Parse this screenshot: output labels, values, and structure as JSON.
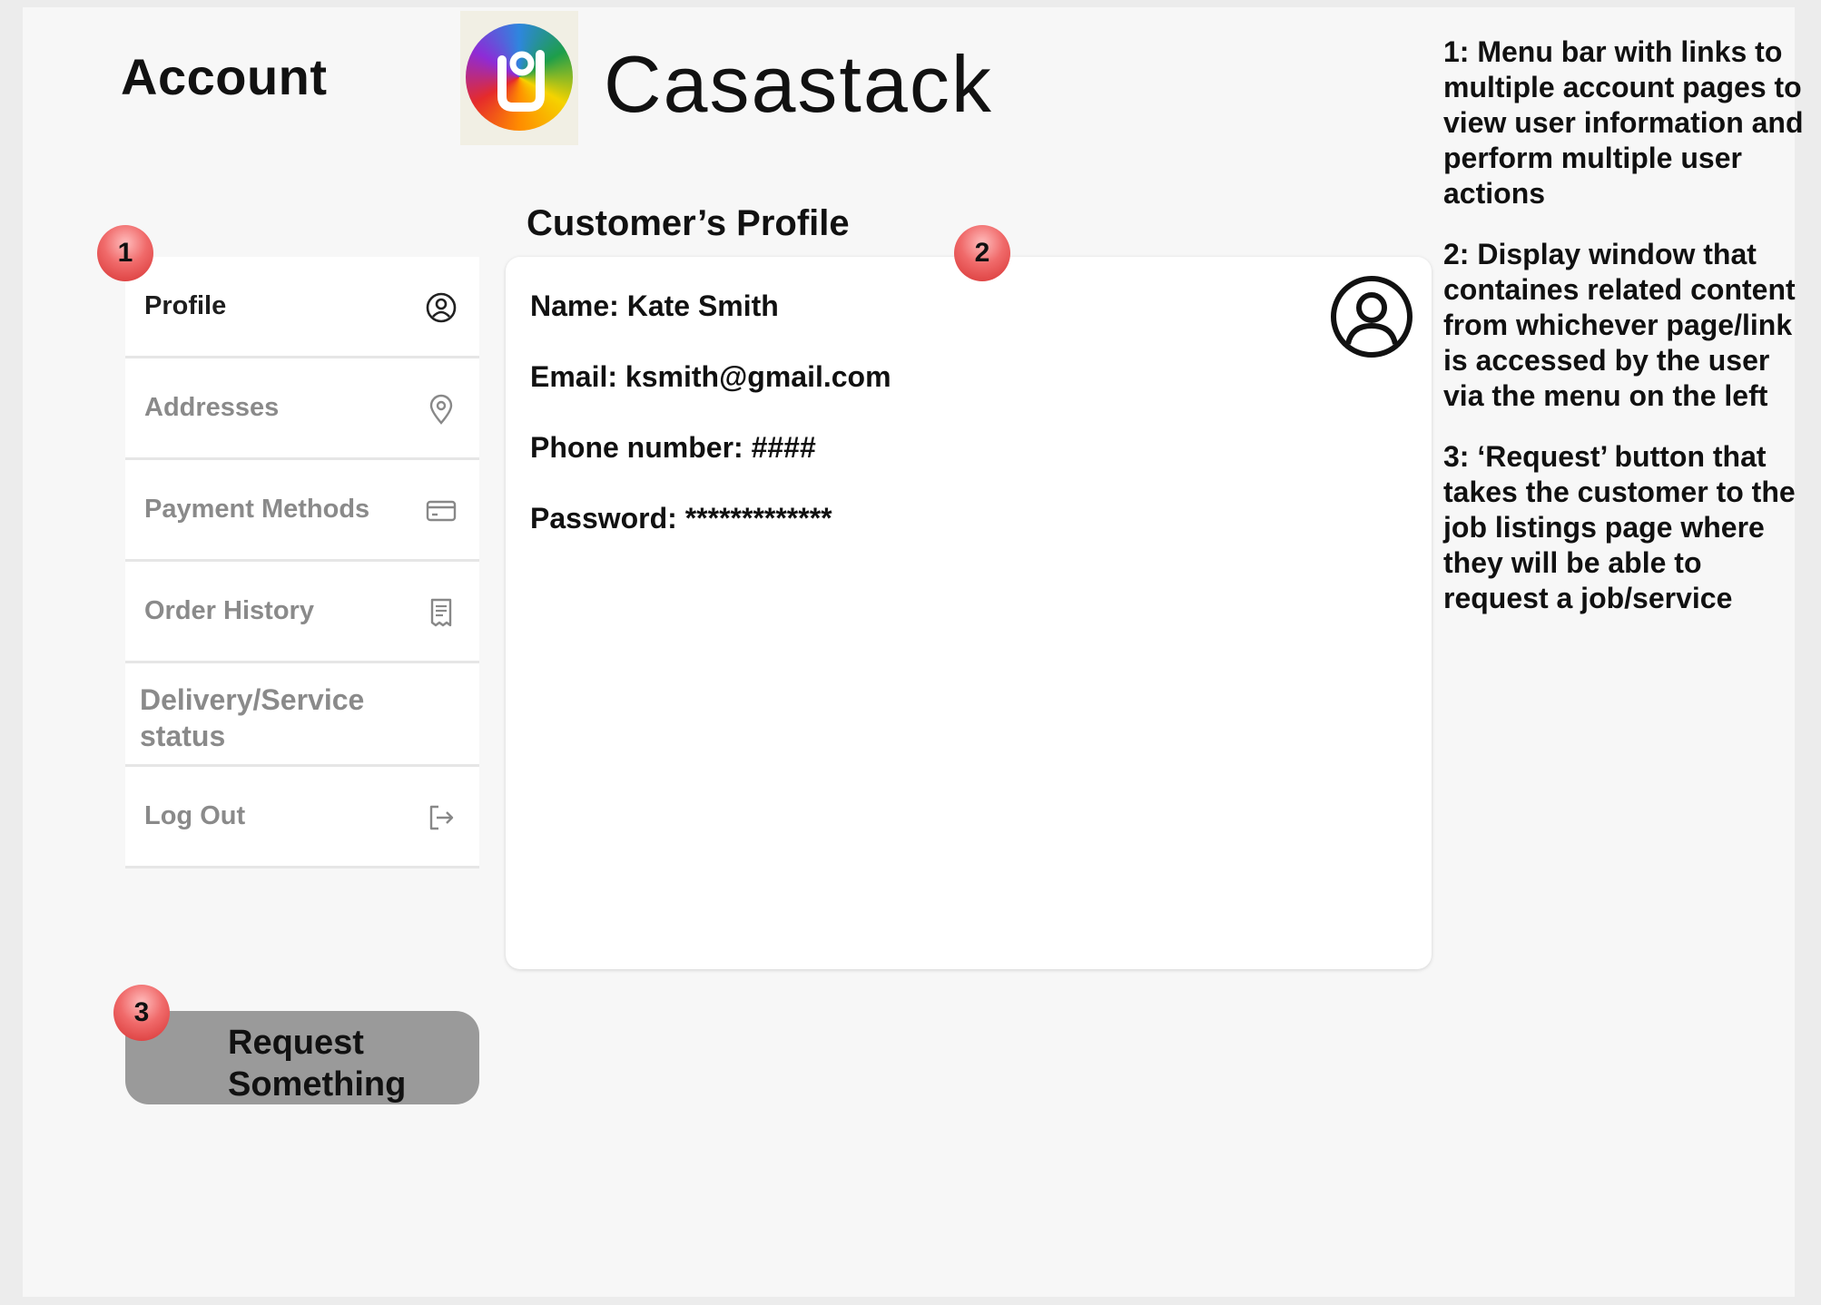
{
  "header": {
    "page_title": "Account",
    "brand_name": "Casastack"
  },
  "menu": {
    "items": [
      {
        "label": "Profile",
        "icon": "user-circle-icon",
        "active": true
      },
      {
        "label": "Addresses",
        "icon": "location-pin-icon",
        "active": false
      },
      {
        "label": "Payment Methods",
        "icon": "credit-card-icon",
        "active": false
      },
      {
        "label": "Order History",
        "icon": "receipt-icon",
        "active": false
      },
      {
        "label": "Delivery/Service status",
        "icon": "",
        "active": false
      },
      {
        "label": "Log Out",
        "icon": "logout-icon",
        "active": false
      }
    ]
  },
  "profile": {
    "title": "Customer’s Profile",
    "name": "Name: Kate Smith",
    "email": "Email: ksmith@gmail.com",
    "phone": "Phone number: ####",
    "password": "Password: *************",
    "avatar_icon": "user-avatar-icon"
  },
  "request_button": {
    "label_line1": "Request",
    "label_line2": "Something"
  },
  "badges": {
    "b1": "1",
    "b2": "2",
    "b3": "3"
  },
  "notes": {
    "note1": "1: Menu bar with links to multiple account pages to view user information and perform multiple user actions",
    "note2": "2: Display window that containes related content from whichever page/link is accessed by the user via the menu on the left",
    "note3": "3: ‘Request’ button that takes the customer to the job listings page where they will be able to request a job/service"
  },
  "colors": {
    "badge": "#e04848",
    "active_text": "#1e1e1e",
    "inactive_text": "#8a8a8a",
    "button_bg": "#9a9a9a"
  }
}
